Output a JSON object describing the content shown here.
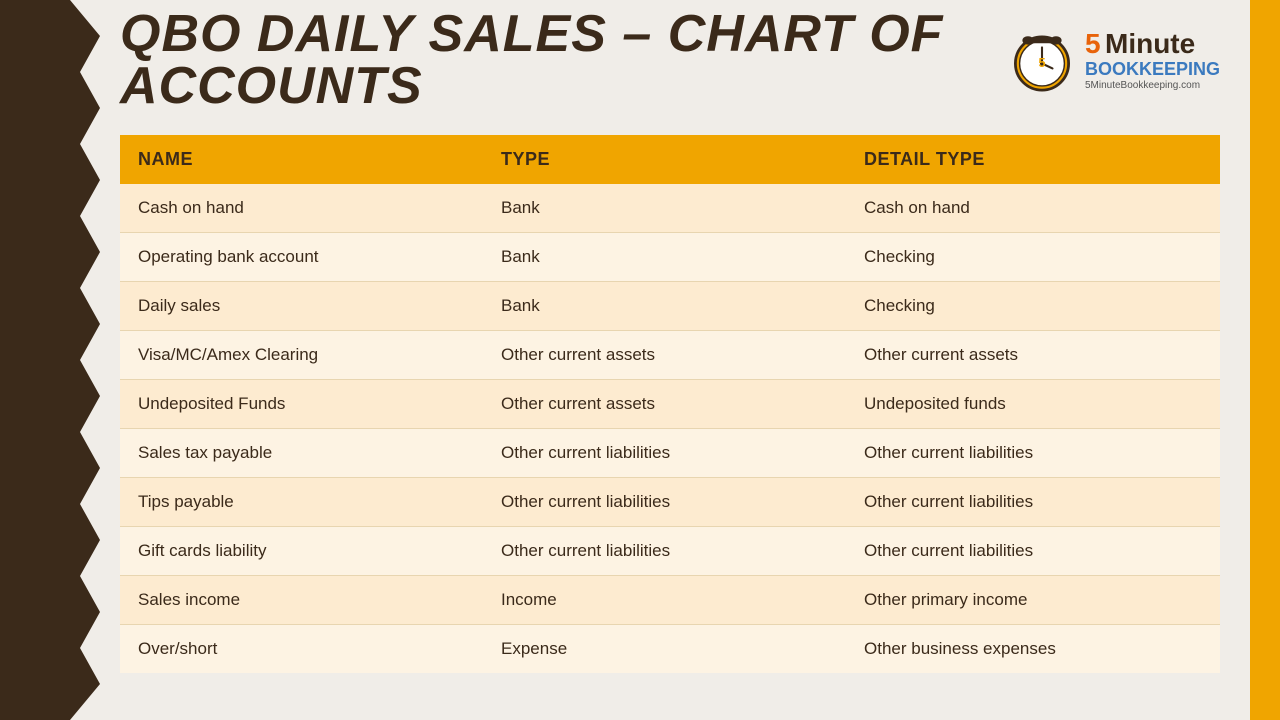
{
  "header": {
    "title": "QBO Daily Sales – Chart of Accounts",
    "logo": {
      "five": "5",
      "minute": "Minute",
      "bookkeeping": "Bookkeeping",
      "url": "5MinuteBookkeeping.com"
    }
  },
  "table": {
    "columns": [
      {
        "id": "name",
        "label": "NAME"
      },
      {
        "id": "type",
        "label": "TYPE"
      },
      {
        "id": "detail_type",
        "label": "DETAIL TYPE"
      }
    ],
    "rows": [
      {
        "name": "Cash on hand",
        "type": "Bank",
        "detail_type": "Cash on hand"
      },
      {
        "name": "Operating bank account",
        "type": "Bank",
        "detail_type": "Checking"
      },
      {
        "name": "Daily sales",
        "type": "Bank",
        "detail_type": "Checking"
      },
      {
        "name": "Visa/MC/Amex Clearing",
        "type": "Other current assets",
        "detail_type": "Other current assets"
      },
      {
        "name": "Undeposited Funds",
        "type": "Other current assets",
        "detail_type": "Undeposited funds"
      },
      {
        "name": "Sales tax payable",
        "type": "Other current liabilities",
        "detail_type": "Other current liabilities"
      },
      {
        "name": "Tips payable",
        "type": "Other current liabilities",
        "detail_type": "Other current liabilities"
      },
      {
        "name": "Gift cards liability",
        "type": "Other current liabilities",
        "detail_type": "Other current liabilities"
      },
      {
        "name": "Sales income",
        "type": "Income",
        "detail_type": "Other primary income"
      },
      {
        "name": "Over/short",
        "type": "Expense",
        "detail_type": "Other business expenses"
      }
    ]
  },
  "colors": {
    "header_bg": "#f0ede8",
    "sidebar_dark": "#3b2a1a",
    "sidebar_gold": "#f0a500",
    "table_header": "#f0a500",
    "row_odd": "#fdebd0",
    "row_even": "#fdf3e3",
    "text_dark": "#3b2a1a"
  }
}
